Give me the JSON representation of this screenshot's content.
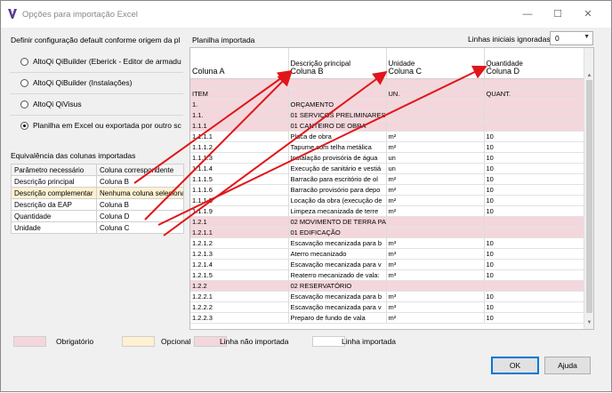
{
  "window": {
    "title": "Opções para importação Excel"
  },
  "titlebar_buttons": {
    "minimize": "—",
    "maximize": "☐",
    "close": "✕"
  },
  "left": {
    "config_title": "Definir configuração default conforme origem da pl",
    "options": [
      {
        "label": "AltoQi QiBuilder (Eberick - Editor de armadu",
        "checked": false
      },
      {
        "label": "AltoQi QiBuilder (Instalações)",
        "checked": false
      },
      {
        "label": "AltoQi QiVisus",
        "checked": false
      },
      {
        "label": "Planilha em Excel ou exportada por outro sc",
        "checked": true
      }
    ],
    "equiv_title": "Equivalência das colunas importadas",
    "headers": [
      "Parâmetro necessário",
      "Coluna correspondente"
    ],
    "rows": [
      {
        "param": "Descrição principal",
        "col": "Coluna B",
        "optional": false
      },
      {
        "param": "Descrição complementar",
        "col": "Nenhuma coluna selecionada",
        "optional": true
      },
      {
        "param": "Descrição da EAP",
        "col": "Coluna B",
        "optional": false
      },
      {
        "param": "Quantidade",
        "col": "Coluna D",
        "optional": false
      },
      {
        "param": "Unidade",
        "col": "Coluna C",
        "optional": false
      }
    ]
  },
  "right": {
    "sheet_title": "Planilha importada",
    "skip_label": "Linhas iniciais ignoradas",
    "skip_value": "0",
    "col_headers": [
      {
        "top": "",
        "bottom": "Coluna A"
      },
      {
        "top": "Descrição principal",
        "bottom": "Coluna B"
      },
      {
        "top": "Unidade",
        "bottom": "Coluna C"
      },
      {
        "top": "Quantidade",
        "bottom": "Coluna D"
      }
    ],
    "rows": [
      {
        "a": "",
        "b": "",
        "c": "",
        "d": "",
        "ni": true
      },
      {
        "a": "ITEM",
        "b": "",
        "c": "UN.",
        "d": "QUANT.",
        "ni": true
      },
      {
        "a": "1.",
        "b": "ORÇAMENTO",
        "c": "",
        "d": "",
        "ni": true
      },
      {
        "a": "1.1.",
        "b": "01 SERVIÇOS PRELIMINARES",
        "c": "",
        "d": "",
        "ni": true
      },
      {
        "a": "1.1.1",
        "b": "01 CANTEIRO DE OBRA",
        "c": "",
        "d": "",
        "ni": true
      },
      {
        "a": "1.1.1.1",
        "b": "Placa de obra",
        "c": "m²",
        "d": "10",
        "ni": false
      },
      {
        "a": "1.1.1.2",
        "b": "Tapume com telha metálica",
        "c": "m²",
        "d": "10",
        "ni": false
      },
      {
        "a": "1.1.1.3",
        "b": "Instalação provisória de água",
        "c": "un",
        "d": "10",
        "ni": false
      },
      {
        "a": "1.1.1.4",
        "b": "Execução de sanitário e vestiá",
        "c": "un",
        "d": "10",
        "ni": false
      },
      {
        "a": "1.1.1.5",
        "b": "Barracão para escritório de ol",
        "c": "m²",
        "d": "10",
        "ni": false
      },
      {
        "a": "1.1.1.6",
        "b": "Barracão provisório para depo",
        "c": "m²",
        "d": "10",
        "ni": false
      },
      {
        "a": "1.1.1.8",
        "b": "Locação da obra (execução de",
        "c": "m²",
        "d": "10",
        "ni": false
      },
      {
        "a": "1.1.1.9",
        "b": "Limpeza mecanizada de terre",
        "c": "m²",
        "d": "10",
        "ni": false
      },
      {
        "a": "1.2.1",
        "b": "02 MOVIMENTO DE TERRA PA",
        "c": "",
        "d": "",
        "ni": true
      },
      {
        "a": "1.2.1.1",
        "b": "01 EDIFICAÇÃO",
        "c": "",
        "d": "",
        "ni": true
      },
      {
        "a": "1.2.1.2",
        "b": "Escavação mecanizada para b",
        "c": "m³",
        "d": "10",
        "ni": false
      },
      {
        "a": "1.2.1.3",
        "b": "Aterro mecanizado",
        "c": "m³",
        "d": "10",
        "ni": false
      },
      {
        "a": "1.2.1.4",
        "b": "Escavação mecanizada para v",
        "c": "m³",
        "d": "10",
        "ni": false
      },
      {
        "a": "1.2.1.5",
        "b": "Reaterro mecanizado de vala:",
        "c": "m³",
        "d": "10",
        "ni": false
      },
      {
        "a": "1.2.2",
        "b": "02 RESERVATÓRIO",
        "c": "",
        "d": "",
        "ni": true
      },
      {
        "a": "1.2.2.1",
        "b": "Escavação mecanizada para b",
        "c": "m³",
        "d": "10",
        "ni": false
      },
      {
        "a": "1.2.2.2",
        "b": "Escavação mecanizada para v",
        "c": "m³",
        "d": "10",
        "ni": false
      },
      {
        "a": "1.2.2.3",
        "b": "Preparo de fundo de vala",
        "c": "m²",
        "d": "10",
        "ni": false
      }
    ]
  },
  "legend": {
    "obrigatorio": "Obrigatório",
    "opcional": "Opcional",
    "nao_importada": "Linha não importada",
    "importada": "Linha importada",
    "colors": {
      "obrigatorio": "#f4d7dc",
      "opcional": "#fdf1d2",
      "nao_importada": "#f4d7dc",
      "importada": "#ffffff"
    }
  },
  "buttons": {
    "ok": "OK",
    "help": "Ajuda"
  },
  "arrow_color": "#e0161a"
}
